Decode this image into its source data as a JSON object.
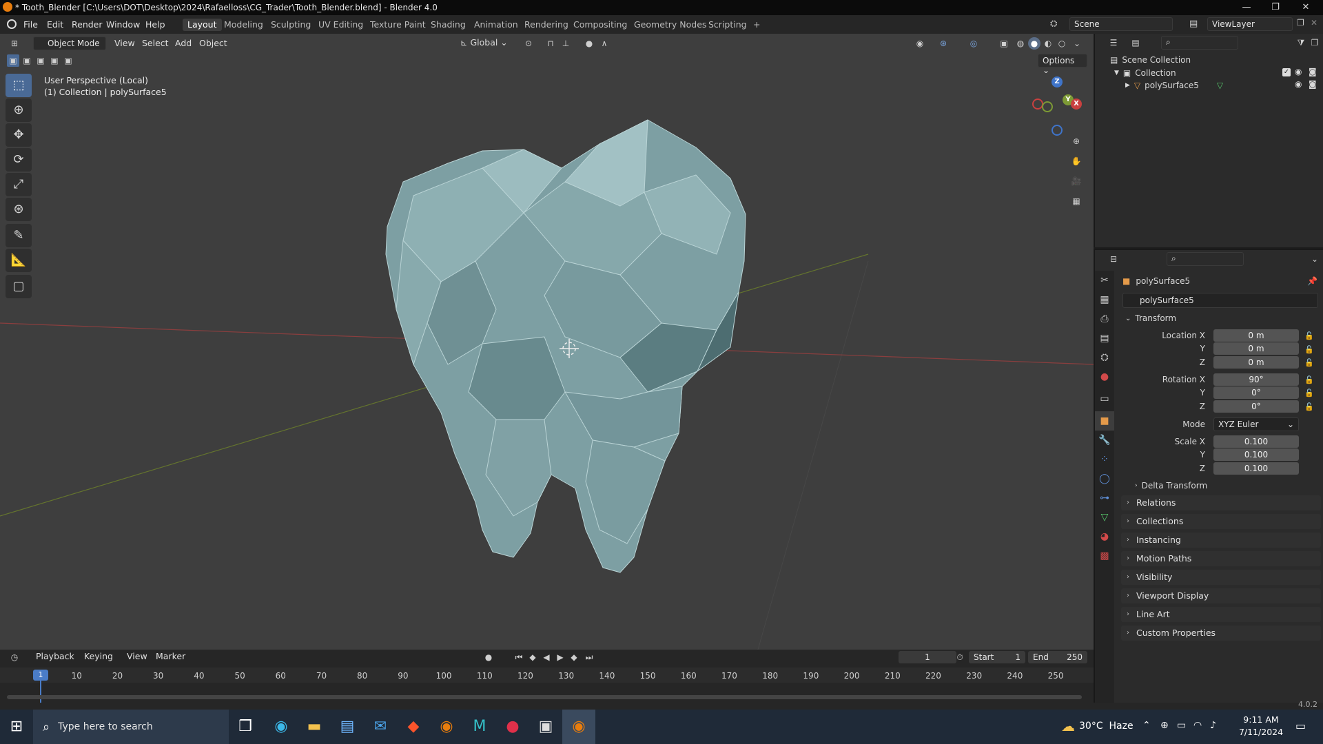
{
  "window": {
    "title": "* Tooth_Blender [C:\\Users\\DOT\\Desktop\\2024\\Rafaelloss\\CG_Trader\\Tooth_Blender.blend] - Blender 4.0",
    "minimize": "—",
    "maximize": "❐",
    "close": "✕"
  },
  "menu": {
    "items": [
      "File",
      "Edit",
      "Render",
      "Window",
      "Help"
    ]
  },
  "workspaces": {
    "tabs": [
      "Layout",
      "Modeling",
      "Sculpting",
      "UV Editing",
      "Texture Paint",
      "Shading",
      "Animation",
      "Rendering",
      "Compositing",
      "Geometry Nodes",
      "Scripting"
    ],
    "active": "Layout",
    "add": "+"
  },
  "scene": {
    "name": "Scene",
    "view_layer": "ViewLayer"
  },
  "viewport": {
    "mode": "Object Mode",
    "menus": [
      "View",
      "Select",
      "Add",
      "Object"
    ],
    "orientation": "Global",
    "options": "Options",
    "perspective_label": "User Perspective (Local)",
    "collection_label": "(1) Collection | polySurface5",
    "gizmo": {
      "z": "Z",
      "y": "Y",
      "x": "X"
    }
  },
  "outliner": {
    "scene_collection": "Scene Collection",
    "collection": "Collection",
    "object": "polySurface5"
  },
  "properties": {
    "object_name": "polySurface5",
    "data_name": "polySurface5",
    "transform_title": "Transform",
    "location": {
      "label": "Location X",
      "x": "0 m",
      "y": "0 m",
      "z": "0 m"
    },
    "rotation": {
      "label": "Rotation X",
      "x": "90°",
      "y": "0°",
      "z": "0°"
    },
    "mode": {
      "label": "Mode",
      "value": "XYZ Euler"
    },
    "scale": {
      "label": "Scale X",
      "x": "0.100",
      "y": "0.100",
      "z": "0.100"
    },
    "axis_y": "Y",
    "axis_z": "Z",
    "delta": "Delta Transform",
    "sections": [
      "Relations",
      "Collections",
      "Instancing",
      "Motion Paths",
      "Visibility",
      "Viewport Display",
      "Line Art",
      "Custom Properties"
    ]
  },
  "timeline": {
    "menus": [
      "Playback",
      "Keying",
      "View",
      "Marker"
    ],
    "current_frame": "1",
    "start_label": "Start",
    "start": "1",
    "end_label": "End",
    "end": "250",
    "ticks": [
      "1",
      "10",
      "20",
      "30",
      "40",
      "50",
      "60",
      "70",
      "80",
      "90",
      "100",
      "110",
      "120",
      "130",
      "140",
      "150",
      "160",
      "170",
      "180",
      "190",
      "200",
      "210",
      "220",
      "230",
      "240",
      "250"
    ]
  },
  "status": {
    "version": "4.0.2"
  },
  "taskbar": {
    "search_placeholder": "Type here to search",
    "weather": "30°C  Haze",
    "time": "9:11 AM",
    "date": "7/11/2024"
  },
  "colors": {
    "accent": "#4a6a96",
    "viewport": "#3e3e3e",
    "tooth": "#7fa2a6",
    "axis_x": "#c9403f",
    "axis_y": "#7d9a35",
    "axis_z": "#3f74c9",
    "frame": "#4a7cc7"
  }
}
